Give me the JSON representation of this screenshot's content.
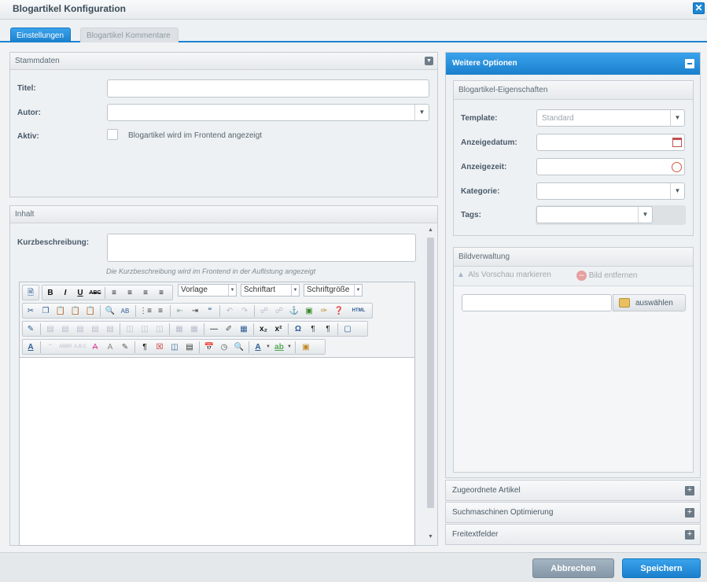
{
  "window": {
    "title": "Blogartikel Konfiguration",
    "close_glyph": "✕"
  },
  "tabs": [
    {
      "label": "Einstellungen",
      "active": true
    },
    {
      "label": "Blogartikel Kommentare",
      "active": false
    }
  ],
  "stammdaten": {
    "header": "Stammdaten",
    "titel_label": "Titel:",
    "titel_value": "",
    "autor_label": "Autor:",
    "autor_value": "",
    "aktiv_label": "Aktiv:",
    "aktiv_checked": false,
    "aktiv_text": "Blogartikel wird im Frontend angezeigt"
  },
  "inhalt": {
    "header": "Inhalt",
    "kurz_label": "Kurzbeschreibung:",
    "kurz_value": "",
    "kurz_hint": "Die Kurzbeschreibung wird im Frontend in der Auflistung angezeigt",
    "editor": {
      "format_select": "Vorlage",
      "font_select": "Schriftart",
      "size_select": "Schriftgröße",
      "html_label": "HTML",
      "content": ""
    }
  },
  "weitere": {
    "header": "Weitere Optionen",
    "eigenschaften": {
      "header": "Blogartikel-Eigenschaften",
      "template_label": "Template:",
      "template_value": "Standard",
      "datum_label": "Anzeigedatum:",
      "datum_value": "",
      "zeit_label": "Anzeigezeit:",
      "zeit_value": "",
      "kategorie_label": "Kategorie:",
      "kategorie_value": "",
      "tags_label": "Tags:",
      "tags_value": ""
    },
    "bildverwaltung": {
      "header": "Bildverwaltung",
      "preview_action": "Als Vorschau markieren",
      "remove_action": "Bild entfernen",
      "file_value": "",
      "select_button": "auswählen"
    },
    "sections": [
      {
        "label": "Zugeordnete Artikel"
      },
      {
        "label": "Suchmaschinen Optimierung"
      },
      {
        "label": "Freitextfelder"
      }
    ]
  },
  "footer": {
    "cancel": "Abbrechen",
    "save": "Speichern"
  },
  "colors": {
    "accent": "#1b83d2",
    "cancel_bg": "#8fa3b3",
    "panel_bg": "#eef1f3"
  }
}
